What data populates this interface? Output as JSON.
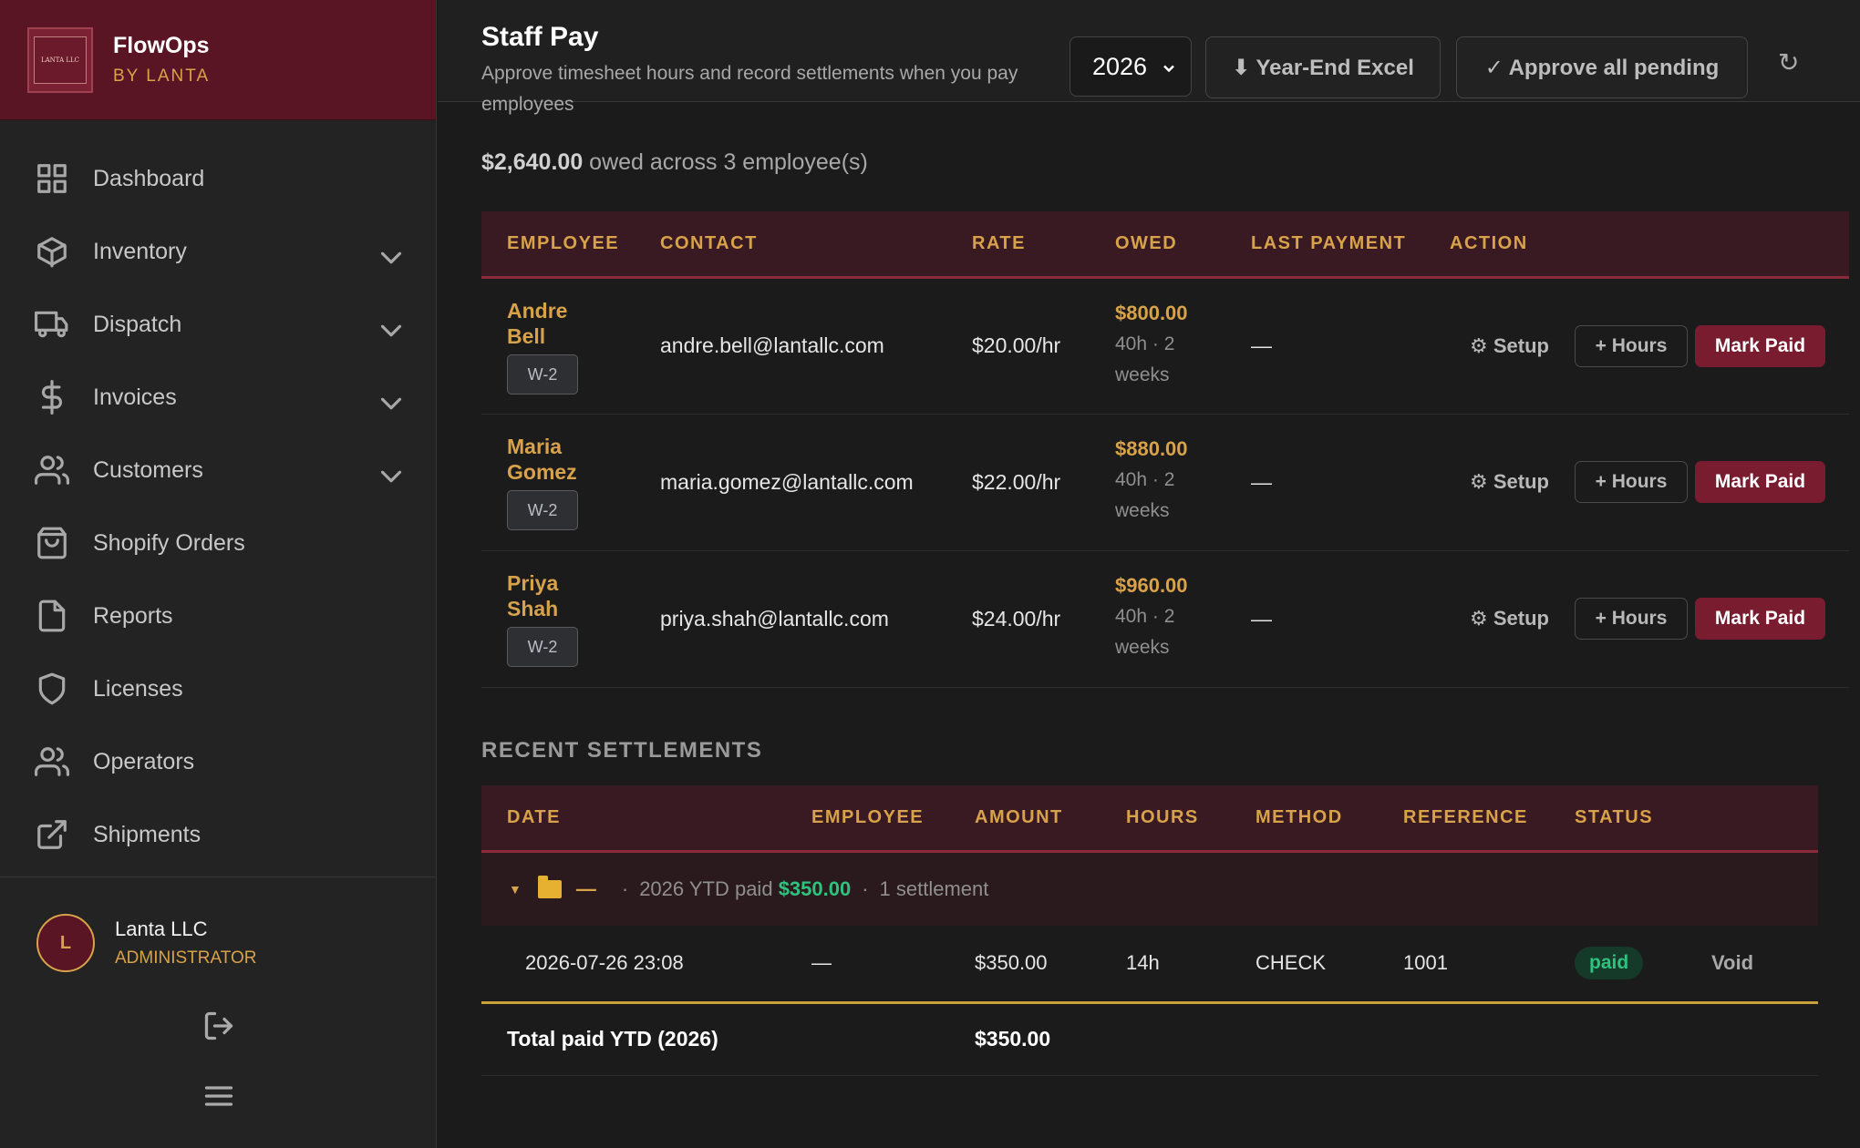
{
  "brand": {
    "title": "FlowOps",
    "subtitle": "BY LANTA",
    "logo_text": "LANTA LLC"
  },
  "nav": [
    {
      "label": "Dashboard",
      "icon": "grid-icon"
    },
    {
      "label": "Inventory",
      "icon": "box-icon",
      "expandable": true
    },
    {
      "label": "Dispatch",
      "icon": "truck-icon",
      "expandable": true
    },
    {
      "label": "Invoices",
      "icon": "dollar-icon",
      "expandable": true
    },
    {
      "label": "Customers",
      "icon": "users-icon",
      "expandable": true
    },
    {
      "label": "Shopify Orders",
      "icon": "shopping-bag-icon"
    },
    {
      "label": "Reports",
      "icon": "document-icon"
    },
    {
      "label": "Licenses",
      "icon": "shield-icon"
    },
    {
      "label": "Operators",
      "icon": "users-icon"
    },
    {
      "label": "Shipments",
      "icon": "external-link-icon"
    }
  ],
  "user": {
    "initial": "L",
    "name": "Lanta LLC",
    "role": "ADMINISTRATOR"
  },
  "header": {
    "title": "Staff Pay",
    "subtitle": "Approve timesheet hours and record settlements when you pay employees",
    "year": "2026",
    "excel_label": "⬇ Year-End Excel",
    "approve_label": "✓ Approve all pending",
    "refresh_icon": "↻"
  },
  "summary": {
    "amount": "$2,640.00",
    "text": " owed across 3 employee(s)"
  },
  "owed_table": {
    "headers": [
      "EMPLOYEE",
      "CONTACT",
      "RATE",
      "OWED",
      "LAST PAYMENT",
      "ACTION"
    ],
    "rows": [
      {
        "first": "Andre",
        "last": "Bell",
        "type": "W-2",
        "email": "andre.bell@lantallc.com",
        "rate": "$20.00/hr",
        "owed": "$800.00",
        "owed_detail": "40h · 2 weeks",
        "last_payment": "—",
        "setup": "⚙ Setup",
        "hours": "+ Hours",
        "mark_paid": "Mark Paid"
      },
      {
        "first": "Maria",
        "last": "Gomez",
        "type": "W-2",
        "email": "maria.gomez@lantallc.com",
        "rate": "$22.00/hr",
        "owed": "$880.00",
        "owed_detail": "40h · 2 weeks",
        "last_payment": "—",
        "setup": "⚙ Setup",
        "hours": "+ Hours",
        "mark_paid": "Mark Paid"
      },
      {
        "first": "Priya",
        "last": "Shah",
        "type": "W-2",
        "email": "priya.shah@lantallc.com",
        "rate": "$24.00/hr",
        "owed": "$960.00",
        "owed_detail": "40h · 2 weeks",
        "last_payment": "—",
        "setup": "⚙ Setup",
        "hours": "+ Hours",
        "mark_paid": "Mark Paid"
      }
    ]
  },
  "settlements": {
    "title": "RECENT SETTLEMENTS",
    "headers": [
      "DATE",
      "EMPLOYEE",
      "AMOUNT",
      "HOURS",
      "METHOD",
      "REFERENCE",
      "STATUS"
    ],
    "group": {
      "caret": "▼",
      "name": "—",
      "ytd_label": "2026 YTD paid",
      "ytd_amount": "$350.00",
      "count": "1 settlement"
    },
    "rows": [
      {
        "date": "2026-07-26 23:08",
        "employee": "—",
        "amount": "$350.00",
        "hours": "14h",
        "method": "CHECK",
        "reference": "1001",
        "status": "paid",
        "void": "Void"
      }
    ],
    "total_label": "Total paid YTD (2026)",
    "total_amount": "$350.00"
  },
  "colors": {
    "accent": "#d8a24a",
    "brand": "#5a1525",
    "button": "#7a1c30",
    "success": "#2ec27e"
  }
}
